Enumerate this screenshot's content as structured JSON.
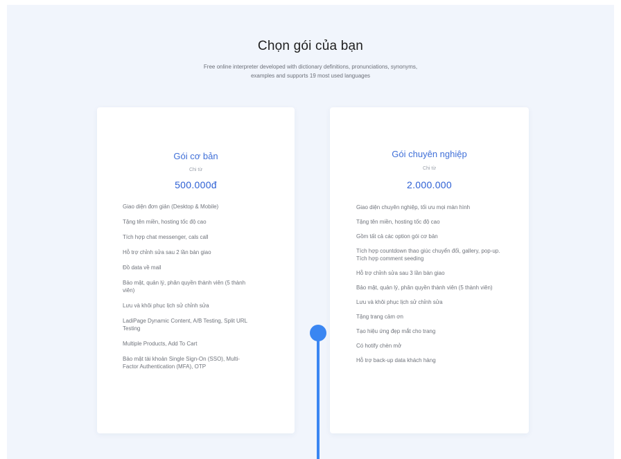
{
  "page": {
    "title": "Chọn gói của bạn",
    "subtitle": "Free online interpreter developed with dictionary definitions, pronunciations, synonyms, examples and supports 19 most used languages"
  },
  "plans": [
    {
      "name": "Gói cơ bản",
      "unit": "Chi từ",
      "price": "500.000đ",
      "features": [
        "Giao diện đơn giản (Desktop & Mobile)",
        "Tặng tên miền, hosting tốc độ cao",
        "Tích hợp chat messenger, cals call",
        "Hỗ trợ chỉnh sửa sau 2 lần bàn giao",
        "Đồ data về mail",
        "Bảo mật, quản lý, phân quyền thành viên (5 thành viên)",
        "Lưu và khôi phục lịch sử chỉnh sửa",
        "LadiPage Dynamic Content, A/B Testing, Split URL Testing",
        "Multiple Products, Add To Cart",
        "Bảo mật tài khoản Single Sign-On (SSO), Multi-Factor Authentication (MFA), OTP"
      ]
    },
    {
      "name": "Gói chuyên nghiệp",
      "unit": "Chi từ",
      "price": "2.000.000",
      "features": [
        "Giao diện chuyên nghiệp, tối ưu mọi màn hình",
        "Tặng tên miền, hosting tốc độ cao",
        "Gồm tất cả các option gói cơ bản",
        "Tích hợp countdown thao giúc chuyển đổi, gallery, pop-up. Tích hợp comment seeding",
        "Hỗ trợ chỉnh sửa sau 3 lần bàn giao",
        "Bảo mật, quản lý, phân quyền thành viên (5 thành viên)",
        "Lưu và khôi phục lịch sử chỉnh sửa",
        "Tặng trang cảm ơn",
        "Tạo hiệu ứng đẹp mắt cho trang",
        "Có hotify chèn mở",
        "Hỗ trợ back-up data khách hàng"
      ]
    }
  ],
  "colors": {
    "accent": "#3f6fd8",
    "timeline": "#3a86f2",
    "background": "#f1f5fc"
  }
}
